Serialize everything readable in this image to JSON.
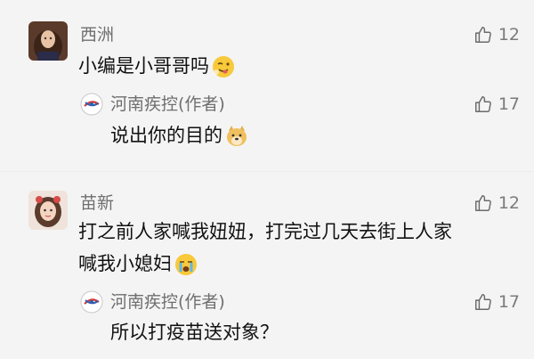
{
  "comments": [
    {
      "author": "西洲",
      "text": "小编是小哥哥吗",
      "likes": "12",
      "reply": {
        "author": "河南疾控(作者)",
        "text": "说出你的目的",
        "likes": "17"
      }
    },
    {
      "author": "苗新",
      "text_line1": "打之前人家喊我妞妞，打完过几天去街上人家",
      "text_line2": "喊我小媳妇",
      "likes": "12",
      "reply": {
        "author": "河南疾控(作者)",
        "text": "所以打疫苗送对象？",
        "likes": "17"
      }
    }
  ],
  "icons": {
    "like": "thumbs-up-icon",
    "author_logo": "henan-cdc-logo-icon",
    "emoji1": "wink-tongue-emoji-icon",
    "emoji2": "doge-emoji-icon",
    "emoji3": "crying-emoji-icon"
  }
}
